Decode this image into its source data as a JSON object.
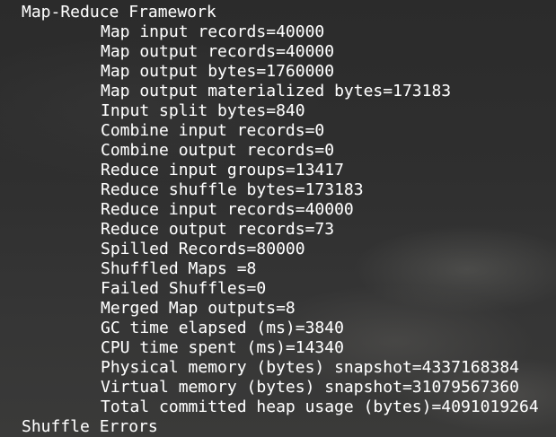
{
  "terminal": {
    "section_title": "Map-Reduce Framework",
    "counters": [
      "Map input records=40000",
      "Map output records=40000",
      "Map output bytes=1760000",
      "Map output materialized bytes=173183",
      "Input split bytes=840",
      "Combine input records=0",
      "Combine output records=0",
      "Reduce input groups=13417",
      "Reduce shuffle bytes=173183",
      "Reduce input records=40000",
      "Reduce output records=73",
      "Spilled Records=80000",
      "Shuffled Maps =8",
      "Failed Shuffles=0",
      "Merged Map outputs=8",
      "GC time elapsed (ms)=3840",
      "CPU time spent (ms)=14340",
      "Physical memory (bytes) snapshot=4337168384",
      "Virtual memory (bytes) snapshot=31079567360",
      "Total committed heap usage (bytes)=4091019264"
    ],
    "next_section": "Shuffle Errors"
  }
}
